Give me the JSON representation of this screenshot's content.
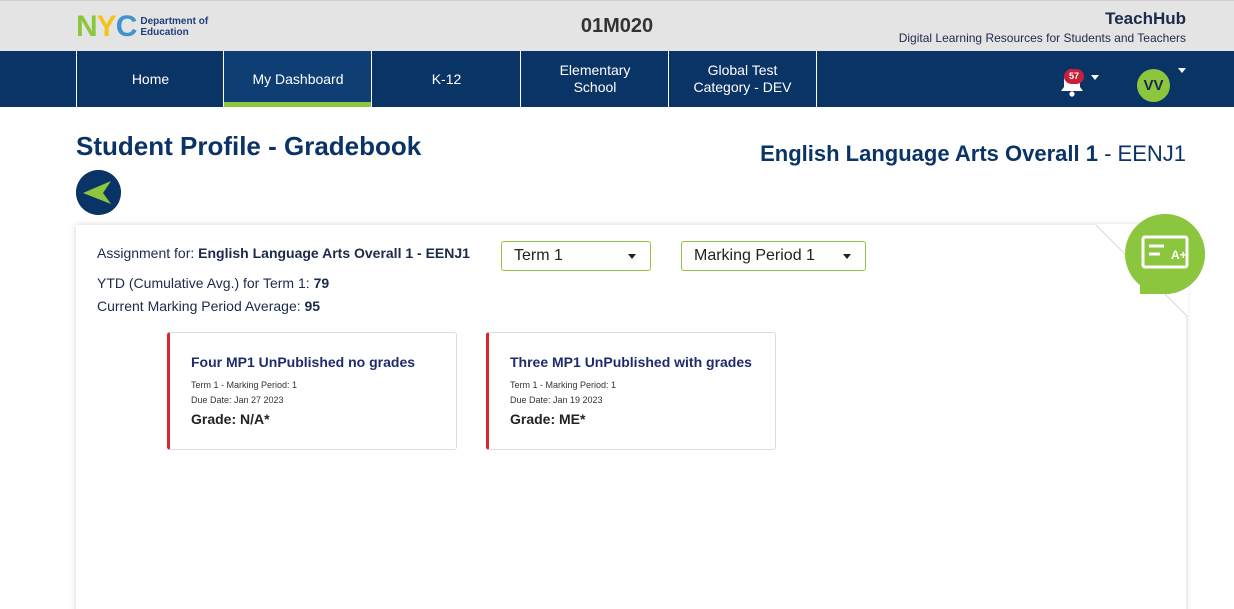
{
  "header": {
    "logo": {
      "letters": [
        "N",
        "Y",
        "C"
      ],
      "text_line1": "Department of",
      "text_line2": "Education"
    },
    "school_code": "01M020",
    "brand_title": "TeachHub",
    "brand_subtitle": "Digital Learning Resources for Students and Teachers"
  },
  "nav": {
    "items": [
      {
        "label": "Home"
      },
      {
        "label": "My Dashboard",
        "active": true
      },
      {
        "label": "K-12"
      },
      {
        "label_line1": "Elementary",
        "label_line2": "School"
      },
      {
        "label_line1": "Global Test",
        "label_line2": "Category - DEV"
      }
    ],
    "notifications_count": "57",
    "notifications_icon": "bell-icon",
    "user_initials": "VV"
  },
  "page": {
    "title": "Student Profile - Gradebook",
    "course_name": "English Language Arts Overall 1",
    "course_separator": " - ",
    "course_code": "EENJ1",
    "back_icon": "arrow-left-icon"
  },
  "gradebook": {
    "assignment_for_label": "Assignment for:",
    "assignment_for_value": "English Language Arts Overall 1 - EENJ1",
    "ytd_label": "YTD (Cumulative Avg.) for Term 1:",
    "ytd_value": "79",
    "current_mp_label": "Current Marking Period Average:",
    "current_mp_value": "95",
    "term_select": {
      "value": "Term 1"
    },
    "marking_period_select": {
      "value": "Marking Period 1"
    },
    "badge_icon": "gradebook-icon"
  },
  "assignments": [
    {
      "title": "Four MP1 UnPublished no grades",
      "term_period": "Term 1 - Marking Period: 1",
      "due_date": "Due Date: Jan 27 2023",
      "grade": "Grade: N/A*"
    },
    {
      "title": "Three MP1 UnPublished with grades",
      "term_period": "Term 1 - Marking Period: 1",
      "due_date": "Due Date: Jan 19 2023",
      "grade": "Grade: ME*"
    }
  ],
  "colors": {
    "navy": "#0b3466",
    "green": "#8cc63f",
    "red_accent": "#d7262e",
    "badge_red": "#c7203a"
  }
}
